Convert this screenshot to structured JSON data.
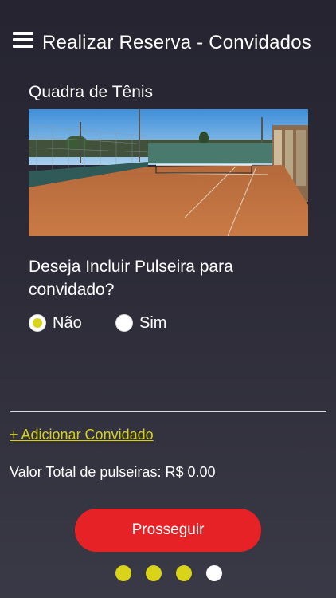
{
  "header": {
    "title": "Realizar Reserva - Convidados",
    "menu_icon": "hamburger-menu-icon"
  },
  "court": {
    "name": "Quadra de Tênis",
    "image": "tennis-court-photo"
  },
  "bracelet": {
    "question": "Deseja Incluir Pulseira para convidado?",
    "options": [
      {
        "label": "Não",
        "selected": true
      },
      {
        "label": "Sim",
        "selected": false
      }
    ]
  },
  "add_guest_label": "+ Adicionar Convidado",
  "total": {
    "label": "Valor Total de pulseiras: R$ 0.00"
  },
  "proceed_label": "Prosseguir",
  "pagination": {
    "total_pages": 4,
    "current_page": 4
  },
  "colors": {
    "accent_yellow": "#d9d319",
    "button_red": "#e62226",
    "background": "#2c2b37"
  }
}
